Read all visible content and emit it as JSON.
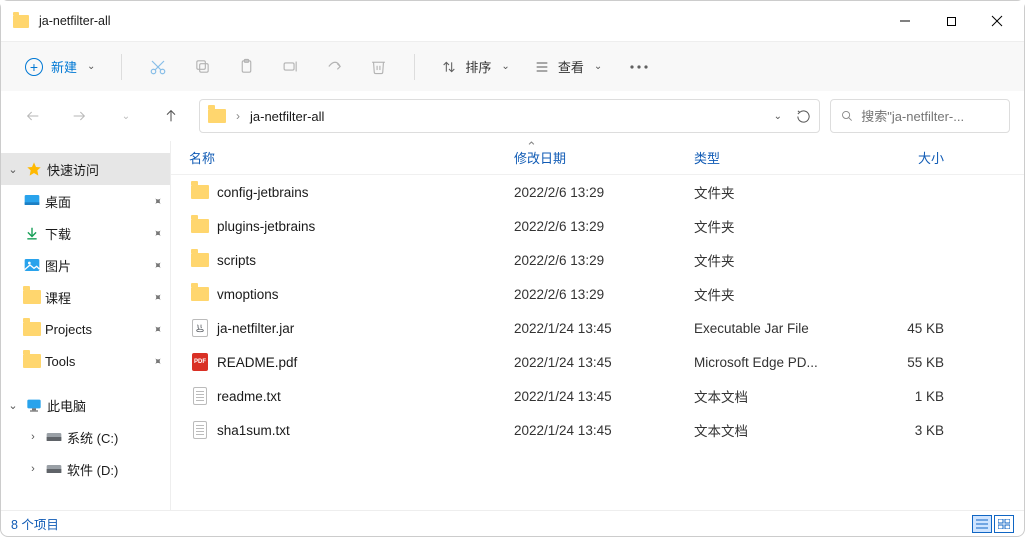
{
  "window": {
    "title": "ja-netfilter-all"
  },
  "toolbar": {
    "new_label": "新建",
    "sort_label": "排序",
    "view_label": "查看"
  },
  "address": {
    "path": "ja-netfilter-all"
  },
  "search": {
    "placeholder": "搜索\"ja-netfilter-..."
  },
  "columns": {
    "name": "名称",
    "date": "修改日期",
    "type": "类型",
    "size": "大小"
  },
  "sidebar": {
    "quick": "快速访问",
    "desktop": "桌面",
    "downloads": "下载",
    "pictures": "图片",
    "courses": "课程",
    "projects": "Projects",
    "tools": "Tools",
    "thispc": "此电脑",
    "drive_c": "系统 (C:)",
    "drive_d": "软件 (D:)"
  },
  "files": [
    {
      "icon": "folder",
      "name": "config-jetbrains",
      "date": "2022/2/6 13:29",
      "type": "文件夹",
      "size": ""
    },
    {
      "icon": "folder",
      "name": "plugins-jetbrains",
      "date": "2022/2/6 13:29",
      "type": "文件夹",
      "size": ""
    },
    {
      "icon": "folder",
      "name": "scripts",
      "date": "2022/2/6 13:29",
      "type": "文件夹",
      "size": ""
    },
    {
      "icon": "folder",
      "name": "vmoptions",
      "date": "2022/2/6 13:29",
      "type": "文件夹",
      "size": ""
    },
    {
      "icon": "jar",
      "name": "ja-netfilter.jar",
      "date": "2022/1/24 13:45",
      "type": "Executable Jar File",
      "size": "45 KB"
    },
    {
      "icon": "pdf",
      "name": "README.pdf",
      "date": "2022/1/24 13:45",
      "type": "Microsoft Edge PD...",
      "size": "55 KB"
    },
    {
      "icon": "txt",
      "name": "readme.txt",
      "date": "2022/1/24 13:45",
      "type": "文本文档",
      "size": "1 KB"
    },
    {
      "icon": "txt",
      "name": "sha1sum.txt",
      "date": "2022/1/24 13:45",
      "type": "文本文档",
      "size": "3 KB"
    }
  ],
  "status": {
    "count_label": "8 个项目"
  }
}
